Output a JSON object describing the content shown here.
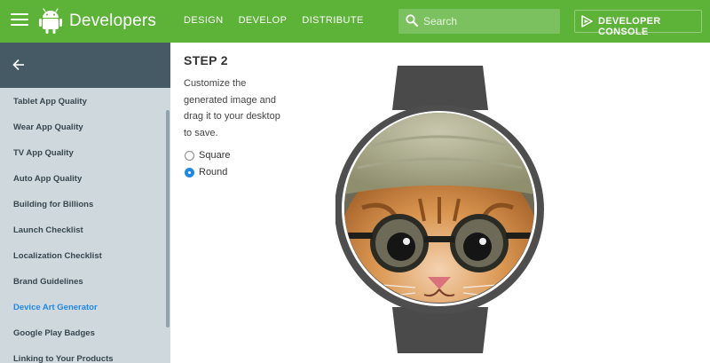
{
  "header": {
    "brand": "Developers",
    "nav": [
      "DESIGN",
      "DEVELOP",
      "DISTRIBUTE"
    ],
    "search_placeholder": "Search",
    "console_label": "DEVELOPER CONSOLE",
    "color": "#5cb338"
  },
  "sidebar": {
    "items": [
      "Tablet App Quality",
      "Wear App Quality",
      "TV App Quality",
      "Auto App Quality",
      "Building for Billions",
      "Launch Checklist",
      "Localization Checklist",
      "Brand Guidelines",
      "Device Art Generator",
      "Google Play Badges",
      "Linking to Your Products"
    ],
    "active_item": "Device Art Generator",
    "active_color": "#1e88e5"
  },
  "main": {
    "step_title": "STEP 2",
    "step_description": "Customize the generated image and drag it to your desktop to save.",
    "options": [
      {
        "label": "Square",
        "checked": false
      },
      {
        "label": "Round",
        "checked": true
      }
    ]
  }
}
